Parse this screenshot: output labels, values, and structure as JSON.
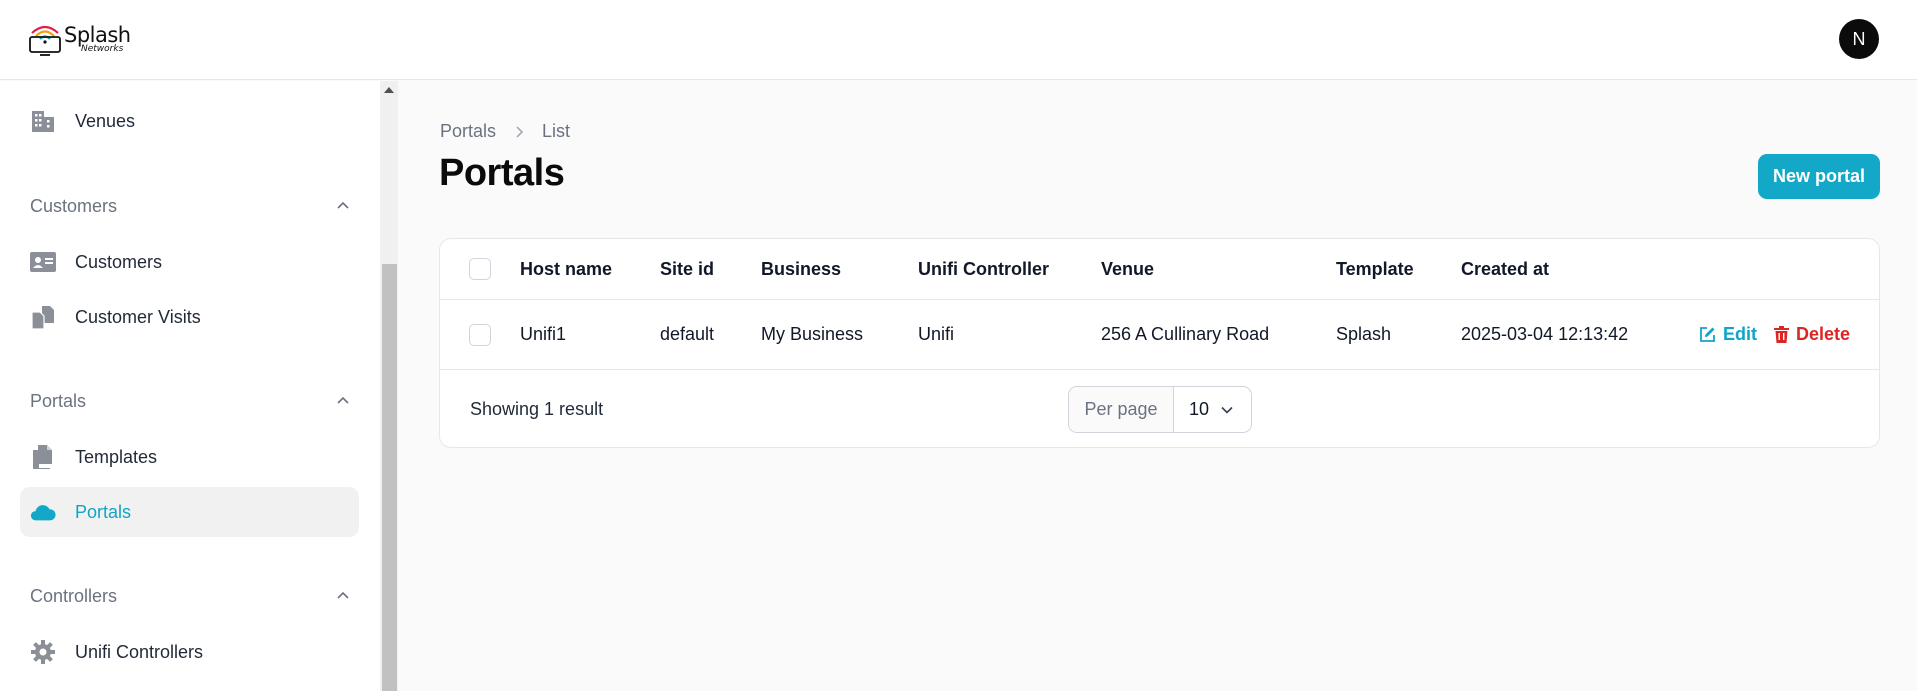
{
  "app": {
    "logo_text": "Splash",
    "logo_subtext": "Networks",
    "avatar_initial": "N"
  },
  "sidebar": {
    "items_top": [
      {
        "label": "Venues",
        "icon": "building-icon"
      }
    ],
    "groups": [
      {
        "title": "Customers",
        "items": [
          {
            "label": "Customers",
            "icon": "id-card-icon"
          },
          {
            "label": "Customer Visits",
            "icon": "documents-icon"
          }
        ]
      },
      {
        "title": "Portals",
        "items": [
          {
            "label": "Templates",
            "icon": "document-duplicate-icon"
          },
          {
            "label": "Portals",
            "icon": "cloud-icon",
            "active": true
          }
        ]
      },
      {
        "title": "Controllers",
        "items": [
          {
            "label": "Unifi Controllers",
            "icon": "gear-icon"
          }
        ]
      }
    ]
  },
  "breadcrumb": {
    "items": [
      "Portals",
      "List"
    ]
  },
  "page": {
    "title": "Portals",
    "new_button": "New portal"
  },
  "table": {
    "columns": [
      "Host name",
      "Site id",
      "Business",
      "Unifi Controller",
      "Venue",
      "Template",
      "Created at"
    ],
    "rows": [
      {
        "cells": [
          "Unifi1",
          "default",
          "My Business",
          "Unifi",
          "256 A Cullinary Road",
          "Splash",
          "2025-03-04 12:13:42"
        ],
        "edit_label": "Edit",
        "delete_label": "Delete"
      }
    ],
    "footer": {
      "result_text": "Showing 1 result",
      "per_page_label": "Per page",
      "per_page_value": "10"
    }
  },
  "colors": {
    "accent": "#14a8c8",
    "danger": "#dc2626",
    "icon_gray": "#8a8f98"
  }
}
